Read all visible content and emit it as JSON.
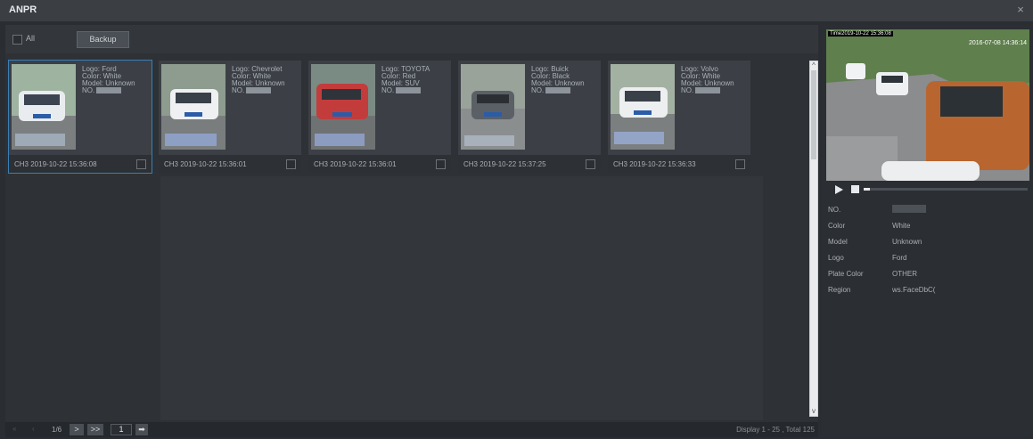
{
  "window": {
    "title": "ANPR",
    "close_glyph": "×"
  },
  "toolbar": {
    "all_label": "All",
    "backup_label": "Backup"
  },
  "cards": [
    {
      "logo": "Logo: Ford",
      "color": "Color: White",
      "model": "Model: Unknown",
      "no": "NO.",
      "time": "CH3 2019-10-22 15:36:08",
      "selected": true,
      "thumb": {
        "bg": "#9fb3a1",
        "car": "#e9ecef"
      }
    },
    {
      "logo": "Logo: Chevrolet",
      "color": "Color: White",
      "model": "Model: Unknown",
      "no": "NO.",
      "time": "CH3 2019-10-22 15:36:01",
      "selected": false,
      "thumb": {
        "bg": "#8e9c90",
        "car": "#eef0f2"
      }
    },
    {
      "logo": "Logo: TOYOTA",
      "color": "Color: Red",
      "model": "Model: SUV",
      "no": "NO.",
      "time": "CH3 2019-10-22 15:36:01",
      "selected": false,
      "thumb": {
        "bg": "#7a8b84",
        "car": "#c33c3c"
      }
    },
    {
      "logo": "Logo: Buick",
      "color": "Color: Black",
      "model": "Model: Unknown",
      "no": "NO.",
      "time": "CH3 2019-10-22 15:37:25",
      "selected": false,
      "thumb": {
        "bg": "#9aa39a",
        "car": "#5b6066"
      }
    },
    {
      "logo": "Logo: Volvo",
      "color": "Color: White",
      "model": "Model: Unknown",
      "no": "NO.",
      "time": "CH3 2019-10-22 15:36:33",
      "selected": false,
      "thumb": {
        "bg": "#a3b1a2",
        "car": "#eceef0"
      }
    }
  ],
  "pager": {
    "page": "1/6",
    "input": "1",
    "next": ">",
    "last": ">>",
    "go": "➡",
    "total": "Display 1 - 25 , Total 125"
  },
  "scroll": {
    "up": "^",
    "down": "v"
  },
  "preview": {
    "overlay_left": "Time2019-10-22 15:36:08",
    "overlay_right": "2016-07-08 14:36:14",
    "progress": 0.04
  },
  "details": [
    {
      "label": "NO.",
      "value": ""
    },
    {
      "label": "Color",
      "value": "White"
    },
    {
      "label": "Model",
      "value": "Unknown"
    },
    {
      "label": "Logo",
      "value": "Ford"
    },
    {
      "label": "Plate Color",
      "value": "OTHER"
    },
    {
      "label": "Region",
      "value": "ws.FaceDbC("
    }
  ],
  "colors": {
    "accent": "#3a7fb6",
    "panel": "#3c4046",
    "background": "#2a2d31"
  }
}
